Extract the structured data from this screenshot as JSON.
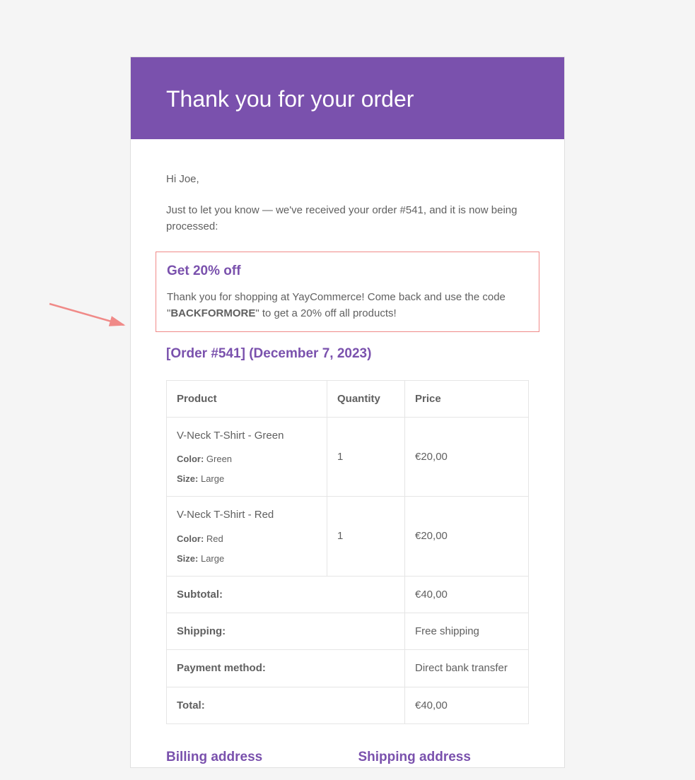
{
  "header": {
    "title": "Thank you for your order"
  },
  "body": {
    "greeting": "Hi Joe,",
    "intro": "Just to let you know — we've received your order #541, and it is now being processed:"
  },
  "promo": {
    "title": "Get 20% off",
    "text_before": "Thank you for shopping at YayCommerce! Come back and use the code \"",
    "code": "BACKFORMORE",
    "text_after": "\" to get a 20% off all products!"
  },
  "order": {
    "heading": "[Order #541] (December 7, 2023)",
    "columns": {
      "product": "Product",
      "quantity": "Quantity",
      "price": "Price"
    },
    "attr_labels": {
      "color": "Color:",
      "size": "Size:"
    },
    "items": [
      {
        "name": "V-Neck T-Shirt - Green",
        "color": "Green",
        "size": "Large",
        "qty": "1",
        "price": "€20,00"
      },
      {
        "name": "V-Neck T-Shirt - Red",
        "color": "Red",
        "size": "Large",
        "qty": "1",
        "price": "€20,00"
      }
    ],
    "summary": {
      "subtotal_label": "Subtotal:",
      "subtotal_value": "€40,00",
      "shipping_label": "Shipping:",
      "shipping_value": "Free shipping",
      "payment_label": "Payment method:",
      "payment_value": "Direct bank transfer",
      "total_label": "Total:",
      "total_value": "€40,00"
    }
  },
  "addresses": {
    "billing_heading": "Billing address",
    "shipping_heading": "Shipping address"
  }
}
